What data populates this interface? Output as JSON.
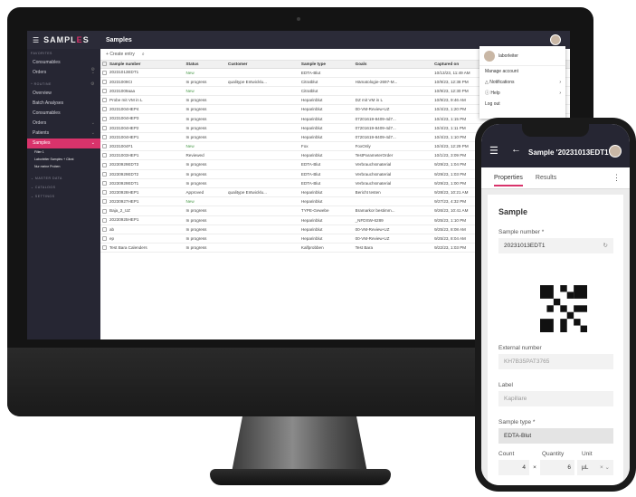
{
  "desktop": {
    "brand": {
      "logo_left": "SAMPL",
      "logo_accent": "E",
      "logo_right": "S"
    },
    "page_title": "Samples",
    "sidebar": {
      "sections": [
        {
          "heading": "FAVORITES",
          "items": [
            "Consumables",
            "Orders"
          ]
        },
        {
          "heading": "ROUTINE",
          "items": [
            "Overview",
            "Batch Analyses",
            "Consumables",
            "Orders",
            "Patients",
            "Samples"
          ]
        }
      ],
      "active_item": "Samples",
      "sub_items": [
        "Filter 1",
        "Laborleiter Samples + Citrat",
        "Nur meine Proben"
      ],
      "collapsed_sections": [
        "MASTER DATA",
        "CATALOGS",
        "SETTINGS"
      ]
    },
    "toolbar": {
      "create_label": "Create entry"
    },
    "table": {
      "columns": [
        "Sample number",
        "Status",
        "Customer",
        "Sample type",
        "Goals",
        "Captured on",
        "Priority",
        "Assignee"
      ],
      "rows": [
        [
          "20231013EDT1",
          "New",
          "",
          "EDTA-Blut",
          "",
          "10/13/23, 11:49 AM",
          "Normal",
          ""
        ],
        [
          "20231009CI",
          "In progress",
          "qualitype Entwicklu...",
          "Citratblut",
          "Hämatologie-2697-M...",
          "10/9/23, 12:38 PM",
          "Urgent",
          "laborleiter"
        ],
        [
          "20231009aaa",
          "New",
          "",
          "Citratblut",
          "",
          "10/9/23, 12:30 PM",
          "Normal",
          ""
        ],
        [
          "Probe mit VM in L",
          "In progress",
          "",
          "Heparinblut",
          "DZ mit VM in L",
          "10/9/23, 9:46 AM",
          "Normal",
          "assistent"
        ],
        [
          "20231004HEP4",
          "In progress",
          "",
          "Heparinblut",
          "00-VM-Review-UZ",
          "10/4/23, 1:20 PM",
          "Normal",
          "laborleiter"
        ],
        [
          "20231004HEP3",
          "In progress",
          "",
          "Heparinblut",
          "07201619-8409-4d7...",
          "10/4/23, 1:15 PM",
          "Normal",
          "laborleiter"
        ],
        [
          "20231004HEP2",
          "In progress",
          "",
          "Heparinblut",
          "07201619-8409-4d7...",
          "10/4/23, 1:11 PM",
          "Normal",
          "laborleiter"
        ],
        [
          "20231004HEP1",
          "In progress",
          "",
          "Heparinblut",
          "07201619-8409-4d7...",
          "10/4/23, 1:10 PM",
          "Normal",
          "laborleiter"
        ],
        [
          "20231004F1",
          "New",
          "",
          "Fox",
          "FoxOnly",
          "10/4/23, 12:29 PM",
          "Normal",
          ""
        ],
        [
          "20231003HEP1",
          "Reviewed",
          "",
          "Heparinblut",
          "TestParameterOrder",
          "10/1/23, 3:09 PM",
          "Normal",
          "laborleiter"
        ],
        [
          "20230929EDT3",
          "In progress",
          "",
          "EDTA-Blut",
          "Verbrauchsmaterial",
          "9/29/23, 1:04 PM",
          "Normal",
          "sebastian"
        ],
        [
          "20230929EDT2",
          "In progress",
          "",
          "EDTA-Blut",
          "Verbrauchsmaterial",
          "9/29/23, 1:03 PM",
          "Normal",
          "sebastian"
        ],
        [
          "20230929EDT1",
          "In progress",
          "",
          "EDTA-Blut",
          "Verbrauchsmaterial",
          "9/29/23, 1:00 PM",
          "Normal",
          "sebastian"
        ],
        [
          "20230928HEP1",
          "Approved",
          "qualitype Entwicklu...",
          "Heparinblut",
          "Bericht testen",
          "9/28/23, 10:21 AM",
          "Normal",
          "sonny"
        ],
        [
          "20230927HEP1",
          "New",
          "",
          "Heparinblut",
          "",
          "9/27/23, 4:32 PM",
          "Normal",
          ""
        ],
        [
          "Baja_2_UZ",
          "In progress",
          "",
          "TYPE-Gewebe",
          "Bramarkor bestimm...",
          "9/26/23, 10:41 AM",
          "Normal",
          "Bajakko"
        ],
        [
          "20230925HEP1",
          "In progress",
          "",
          "Heparinblut",
          "_NFDSW-6289",
          "9/25/23, 1:10 PM",
          "Normal",
          "laborleiter"
        ],
        [
          "ab",
          "In progress",
          "",
          "Heparinblut",
          "00-VM-Review-UZ",
          "9/25/23, 8:08 AM",
          "Normal",
          "admin"
        ],
        [
          "ep",
          "In progress",
          "",
          "Heparinblut",
          "00-VM-Review-UZ",
          "9/25/23, 8:04 AM",
          "Normal",
          "admin"
        ],
        [
          "Test Bara Calenders",
          "In progress",
          "",
          "Kalfprobben",
          "Test Bara",
          "9/22/23, 1:03 PM",
          "Normal",
          "Bajakko"
        ]
      ]
    },
    "user_menu": {
      "username": "laborleiter",
      "items": [
        "Manage account",
        "Notifications",
        "Help",
        "Log out"
      ]
    }
  },
  "phone": {
    "title": "Sample '20231013EDT1'",
    "tabs": [
      "Properties",
      "Results"
    ],
    "active_tab": "Properties",
    "section_heading": "Sample",
    "fields": {
      "sample_number_label": "Sample number *",
      "sample_number_value": "20231013EDT1",
      "external_number_label": "External number",
      "external_number_value": "KH7B35PAT3765",
      "label_label": "Label",
      "label_value": "Kapillare",
      "sample_type_label": "Sample type *",
      "sample_type_value": "EDTA-Blut",
      "count_label": "Count",
      "count_value": "4",
      "quantity_label": "Quantity",
      "quantity_value": "6",
      "unit_label": "Unit",
      "unit_value": "µL",
      "multiply_sign": "×"
    }
  },
  "colors": {
    "accent": "#d9336b",
    "dark_bar": "#2b2b38",
    "sidebar_bg": "#262633"
  }
}
